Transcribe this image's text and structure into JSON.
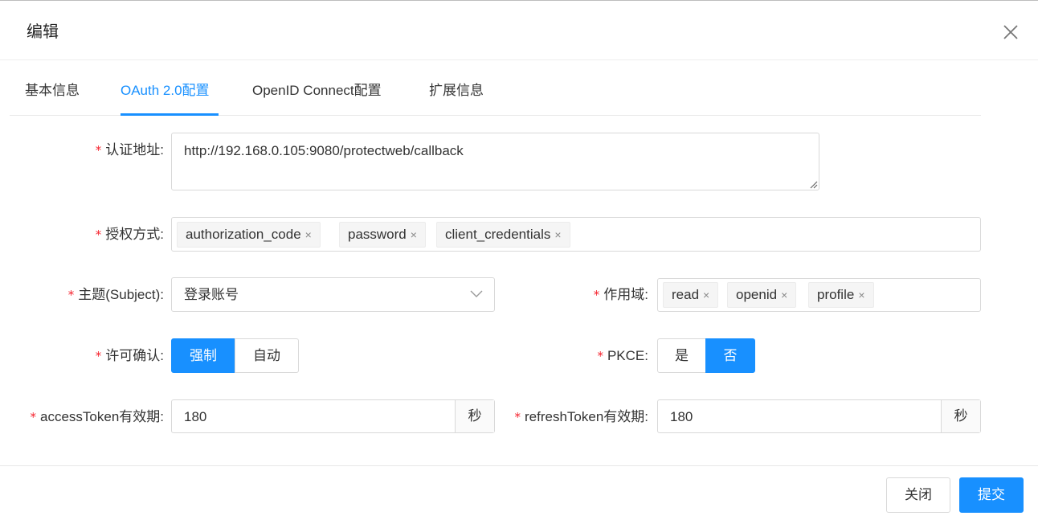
{
  "dialog": {
    "title": "编辑"
  },
  "tabs": [
    {
      "label": "基本信息"
    },
    {
      "label": "OAuth 2.0配置"
    },
    {
      "label": "OpenID Connect配置"
    },
    {
      "label": "扩展信息"
    }
  ],
  "form": {
    "required_mark": "*",
    "redirect_uri": {
      "label": "认证地址:",
      "value": "http://192.168.0.105:9080/protectweb/callback"
    },
    "grant_types": {
      "label": "授权方式:",
      "tags": [
        "authorization_code",
        "password",
        "client_credentials"
      ]
    },
    "subject": {
      "label": "主题(Subject):",
      "value": "登录账号"
    },
    "scope": {
      "label": "作用域:",
      "tags": [
        "read",
        "openid",
        "profile"
      ]
    },
    "consent": {
      "label": "许可确认:",
      "options": [
        "强制",
        "自动"
      ],
      "selected": "强制"
    },
    "pkce": {
      "label": "PKCE:",
      "options": [
        "是",
        "否"
      ],
      "selected": "否"
    },
    "access_token": {
      "label": "accessToken有效期:",
      "value": "180",
      "unit": "秒"
    },
    "refresh_token": {
      "label": "refreshToken有效期:",
      "value": "180",
      "unit": "秒"
    },
    "remove_icon": "×"
  },
  "footer": {
    "close_label": "关闭",
    "submit_label": "提交"
  },
  "colors": {
    "primary": "#1890ff",
    "required": "#f5222d"
  }
}
